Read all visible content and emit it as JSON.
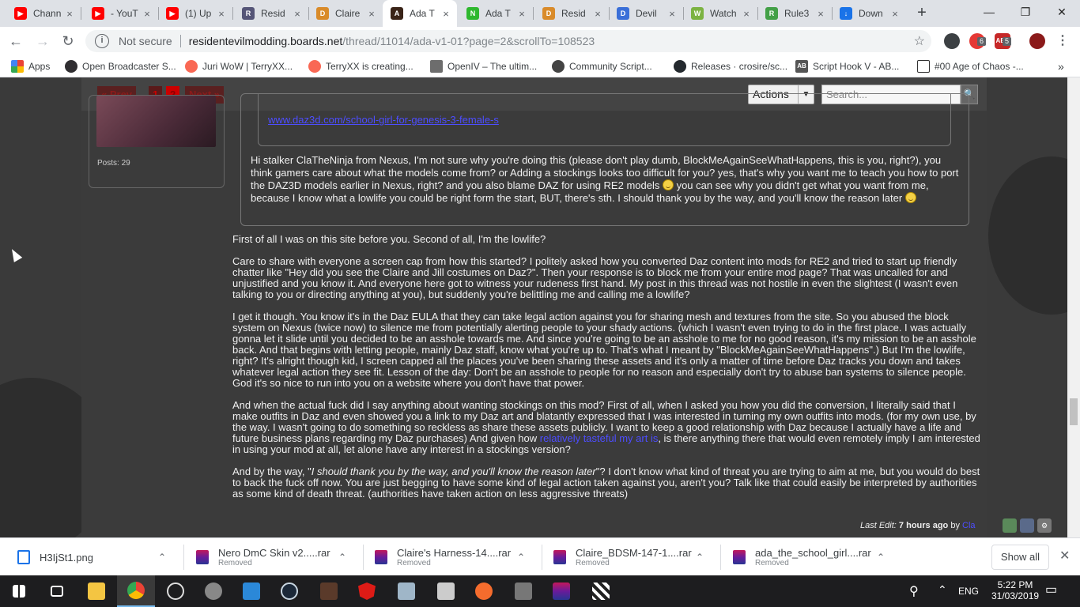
{
  "browser": {
    "tabs": [
      {
        "title": "Chann",
        "fav_color": "#ff0000",
        "fav_glyph": "▶"
      },
      {
        "title": "- YouT",
        "fav_color": "#ff0000",
        "fav_glyph": "▶"
      },
      {
        "title": "(1) Up",
        "fav_color": "#ff0000",
        "fav_glyph": "▶"
      },
      {
        "title": "Resid",
        "fav_color": "#555577",
        "fav_glyph": "R"
      },
      {
        "title": "Claire",
        "fav_color": "#d98b2a",
        "fav_glyph": "D"
      },
      {
        "title": "Ada T",
        "fav_color": "#3a2418",
        "fav_glyph": "A"
      },
      {
        "title": "Ada T",
        "fav_color": "#2eb82e",
        "fav_glyph": "N"
      },
      {
        "title": "Resid",
        "fav_color": "#d98b2a",
        "fav_glyph": "D"
      },
      {
        "title": "Devil",
        "fav_color": "#3a6fd8",
        "fav_glyph": "D"
      },
      {
        "title": "Watch",
        "fav_color": "#7cb342",
        "fav_glyph": "W"
      },
      {
        "title": "Rule3",
        "fav_color": "#43a047",
        "fav_glyph": "R"
      },
      {
        "title": "Down",
        "fav_color": "#1a73e8",
        "fav_glyph": "↓"
      }
    ],
    "close_glyph": "×",
    "new_tab_glyph": "+",
    "window_buttons": {
      "minimize": "—",
      "maximize": "❐",
      "close": "✕"
    },
    "nav": {
      "back": "←",
      "forward": "→",
      "reload": "↻"
    },
    "address": {
      "security_label": "Not secure",
      "host": "residentevilmodding.boards.net",
      "path": "/thread/11014/ada-v1-01?page=2&scrollTo=108523"
    },
    "extensions": {
      "badge_one": "6",
      "badge_two": "5",
      "abp_label": "ABP"
    },
    "bookmarks": [
      {
        "label": "Apps",
        "icon": "apps-icon"
      },
      {
        "label": "Open Broadcaster S...",
        "icon": "obs-icon"
      },
      {
        "label": "Juri WoW | TerryXX...",
        "icon": "patreon-icon"
      },
      {
        "label": "TerryXX is creating...",
        "icon": "patreon-icon"
      },
      {
        "label": "OpenIV – The ultim...",
        "icon": "openiv-icon"
      },
      {
        "label": "Community Script...",
        "icon": "community-icon"
      },
      {
        "label": "Releases · crosire/sc...",
        "icon": "github-icon"
      },
      {
        "label": "Script Hook V - AB...",
        "icon": "ab-icon"
      },
      {
        "label": "#00 Age of Chaos -...",
        "icon": "page-icon"
      }
    ],
    "bookmarks_overflow": "»",
    "bookmark_ab_text": "AB"
  },
  "forum": {
    "pagination": {
      "prev": "« Prev",
      "pages": [
        "1",
        "2"
      ],
      "next": "Next »"
    },
    "actions_label": "Actions",
    "search_placeholder": "Search...",
    "author": {
      "posts_label": "Posts: 29"
    },
    "quote": {
      "link_text": "www.daz3d.com/school-girl-for-genesis-3-female-s",
      "text_part1": "Hi stalker ClaTheNinja from Nexus, I'm not sure why you're doing this (please don't play dumb, BlockMeAgainSeeWhatHappens, this is you, right?), you think gamers care about what the models come from? or Adding a stockings looks too difficult for you? yes, that's why you want me to teach you how to port the DAZ3D models earlier in Nexus, right? and you also blame DAZ for using RE2 models ",
      "text_part2": " you can see why you didn't get what you want from me, because I know what a lowlife you could be right form the start, BUT, there's sth. I should thank you by the way, and you'll know the reason later "
    },
    "post": {
      "p1": "First of all I was on this site before you. Second of all, I'm the lowlife?",
      "p2": "Care to share with everyone a screen cap from how this started? I politely asked how you converted Daz content into mods for RE2 and tried to start up friendly chatter like \"Hey did you see the Claire and Jill costumes on Daz?\". Then your response is to block me from your entire mod page? That was uncalled for and unjustified and you know it. And everyone here got to witness your rudeness first hand. My post in this thread was not hostile in even the slightest (I wasn't even talking to you or directing anything at you), but suddenly you're belittling me and calling me a lowlife?",
      "p3": "I get it though. You know it's in the Daz EULA that they can take legal action against you for sharing mesh and textures from the site. So you abused the block system on Nexus (twice now) to silence me from potentially alerting people to your shady actions. (which I wasn't even trying to do in the first place. I was actually gonna let it slide until you decided to be an asshole towards me. And since you're going to be an asshole to me for no good reason, it's my mission to be an asshole back. And that begins with letting people, mainly Daz staff, know what you're up to. That's what I meant by \"BlockMeAgainSeeWhatHappens\".) But I'm the lowlife, right? It's alright though kid, I screen capped all the places you've been sharing these assets and it's only a matter of time before Daz tracks you down and takes whatever legal action they see fit. Lesson of the day: Don't be an asshole to people for no reason and especially don't try to abuse ban systems to silence people. God it's so nice to run into you on a website where you don't have that power.",
      "p4_before": "And when the actual fuck did I say anything about wanting stockings on this mod? First of all, when I asked you how you did the conversion, I literally said that I make outfits in Daz and even showed you a link to my Daz art and blatantly expressed that I was interested in turning my own outfits into mods. (for my own use, by the way. I wasn't going to do something so reckless as share these assets publicly. I want to keep a good relationship with Daz because I actually have a life and future business plans regarding my Daz purchases) And given how ",
      "p4_link": "relatively tasteful my art is",
      "p4_after": ", is there anything there that would even remotely imply I am interested in using your mod at all, let alone have any interest in a stockings version?",
      "p5_before": "And by the way, \"",
      "p5_quote": "I should thank you by the way, and you'll know the reason later",
      "p5_after": "\"? I don't know what kind of threat you are trying to aim at me, but you would do best to back the fuck off now. You are just begging to have some kind of legal action taken against you, aren't you? Talk like that could easily be interpreted by authorities as some kind of death threat. (authorities have taken action on less aggressive threats)"
    },
    "last_edit": {
      "label": "Last Edit:",
      "when": "7 hours ago",
      "by": "by",
      "user": "Cla"
    }
  },
  "downloads": {
    "items": [
      {
        "name": "H3IjSt1.png",
        "status": "",
        "icon_color": "#1a73e8"
      },
      {
        "name": "Nero DmC Skin v2.....rar",
        "status": "Removed",
        "icon_color": "#8e3a8e"
      },
      {
        "name": "Claire's Harness-14....rar",
        "status": "Removed",
        "icon_color": "#8e3a8e"
      },
      {
        "name": "Claire_BDSM-147-1....rar",
        "status": "Removed",
        "icon_color": "#8e3a8e"
      },
      {
        "name": "ada_the_school_girl....rar",
        "status": "Removed",
        "icon_color": "#8e3a8e"
      }
    ],
    "show_all": "Show all",
    "close_glyph": "✕",
    "chevron_glyph": "⌃"
  },
  "taskbar": {
    "time": "5:22 PM",
    "date": "31/03/2019",
    "lang": "ENG",
    "apps": [
      "start",
      "task-view",
      "file-explorer",
      "chrome",
      "obs",
      "satellite",
      "photos",
      "steam",
      "game",
      "angular",
      "store",
      "xsplit",
      "origin",
      "m-app",
      "winrar",
      "clapper"
    ]
  }
}
